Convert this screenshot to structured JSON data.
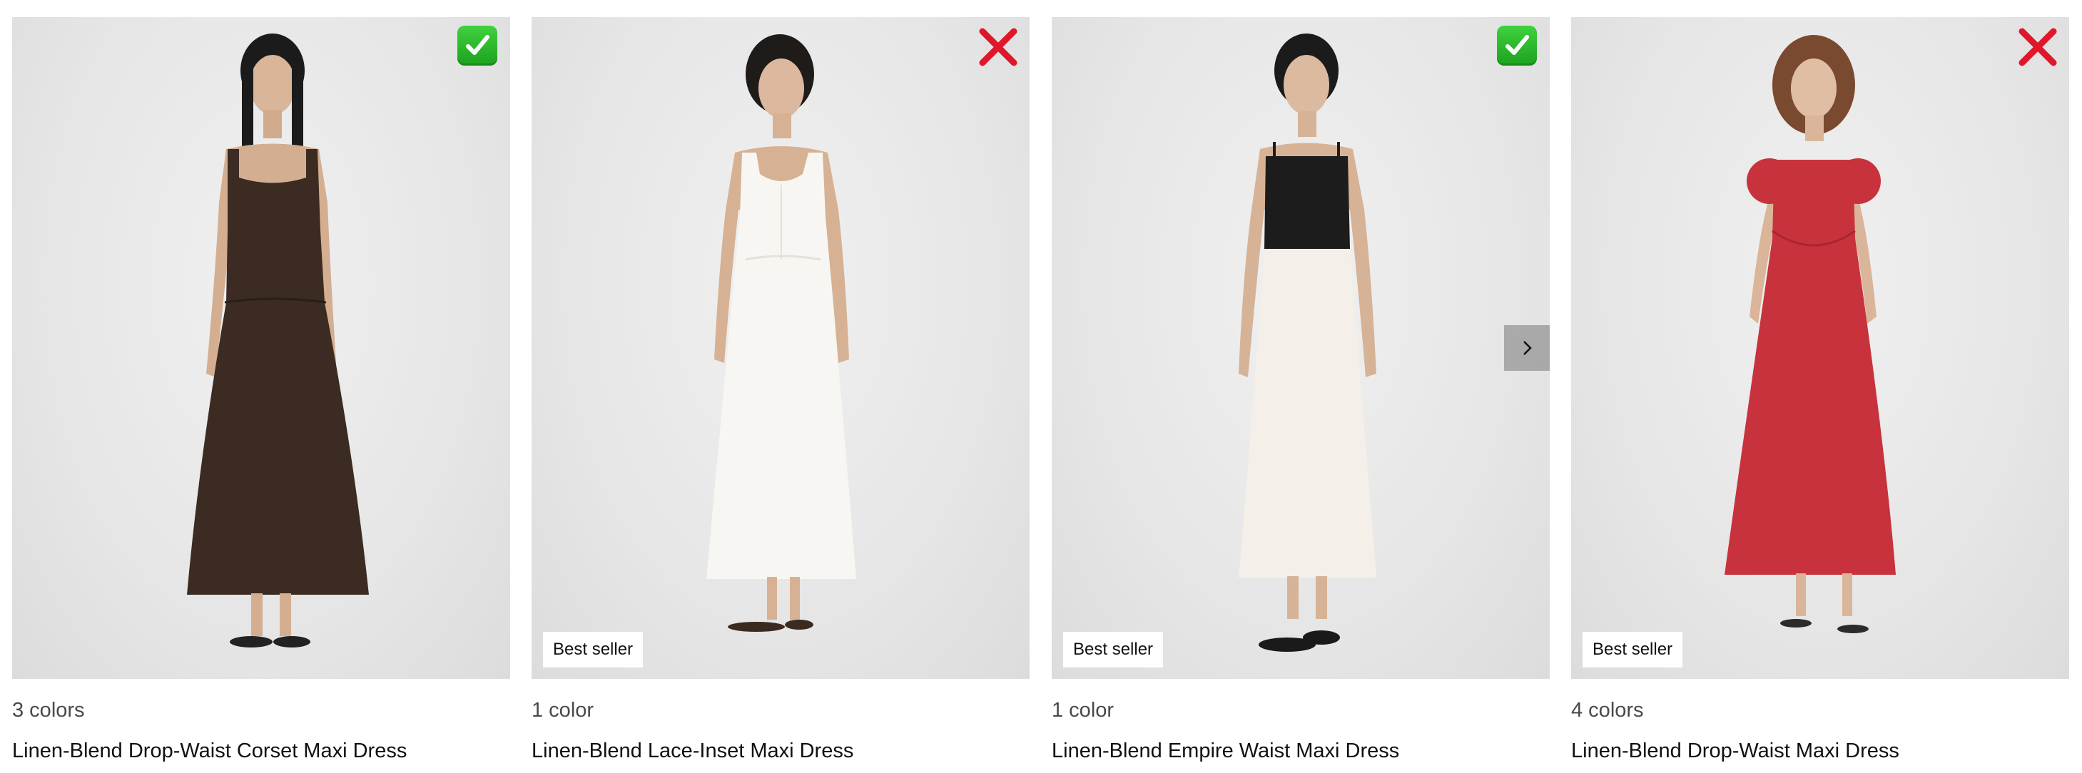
{
  "products": [
    {
      "colors_label": "3 colors",
      "title": "Linen-Blend Drop-Waist Corset Maxi Dress",
      "badge": "",
      "status_icon": "check-mark-icon",
      "dress_color": "#3b2b22"
    },
    {
      "colors_label": "1 color",
      "title": "Linen-Blend Lace-Inset Maxi Dress",
      "badge": "Best seller",
      "status_icon": "cross-mark-icon",
      "dress_color": "#f7f6f2"
    },
    {
      "colors_label": "1 color",
      "title": "Linen-Blend Empire Waist Maxi Dress",
      "badge": "Best seller",
      "status_icon": "check-mark-icon",
      "dress_color": "#f4efe8"
    },
    {
      "colors_label": "4 colors",
      "title": "Linen-Blend Drop-Waist Maxi Dress",
      "badge": "Best seller",
      "status_icon": "cross-mark-icon",
      "dress_color": "#c8323d"
    }
  ],
  "colors": {
    "check_green": "#2fbf2f",
    "cross_red": "#e0162b",
    "accent_black_bodice": "#1c1c1c"
  }
}
